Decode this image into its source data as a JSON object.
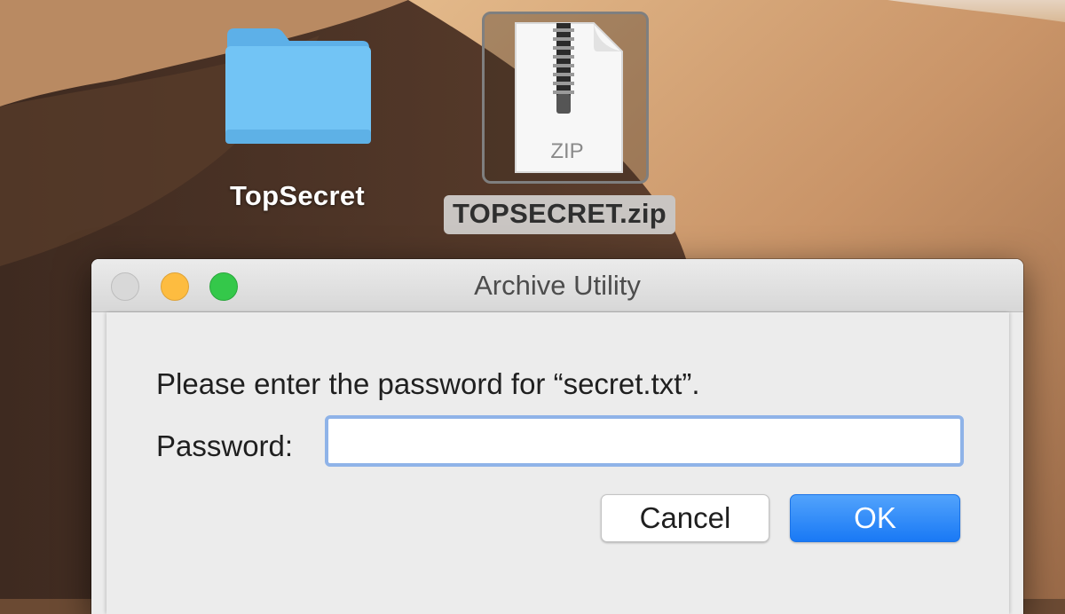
{
  "desktop": {
    "folder": {
      "label": "TopSecret",
      "icon": "folder-icon"
    },
    "zip": {
      "label": "TOPSECRET.zip",
      "icon_text": "ZIP",
      "icon": "zip-archive-icon",
      "selected": true
    }
  },
  "dialog": {
    "title": "Archive Utility",
    "prompt": "Please enter the password for “secret.txt”.",
    "password_label": "Password:",
    "password_value": "",
    "cancel_label": "Cancel",
    "ok_label": "OK"
  },
  "colors": {
    "accent": "#1979f5",
    "input_focus_ring": "#8fb3e8",
    "traffic_close": "#d8d8d8",
    "traffic_minimize": "#fdbc40",
    "traffic_maximize": "#34c84a"
  }
}
